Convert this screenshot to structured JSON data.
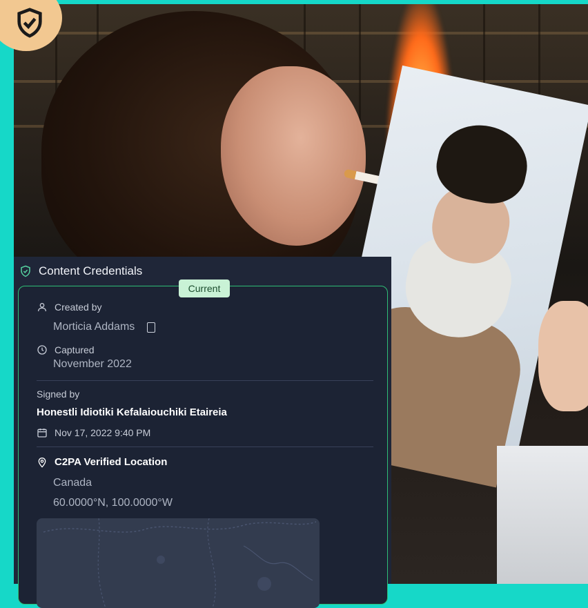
{
  "panel": {
    "title": "Content Credentials",
    "badge": "Current",
    "created_by": {
      "label": "Created by",
      "value": "Morticia Addams"
    },
    "captured": {
      "label": "Captured",
      "value": "November 2022"
    },
    "signed_by": {
      "label": "Signed by",
      "value": "Honestli Idiotiki Kefalaiouchiki Etaireia"
    },
    "signed_date": "Nov 17, 2022 9:40 PM",
    "location": {
      "label": "C2PA Verified Location",
      "country": "Canada",
      "coordinates": "60.0000°N, 100.0000°W"
    }
  },
  "colors": {
    "border": "#16d8c8",
    "panel_bg": "#1f2638",
    "accent_green": "#2fbf76",
    "badge_bg": "#c9f2d6",
    "shield_badge": "#f2c891"
  },
  "icons": {
    "shield_badge": "shield-check-icon",
    "header": "shield-check-icon",
    "created_by": "person-icon",
    "device": "phone-icon",
    "captured": "clock-icon",
    "signed_date": "calendar-icon",
    "location": "location-pin-icon"
  }
}
